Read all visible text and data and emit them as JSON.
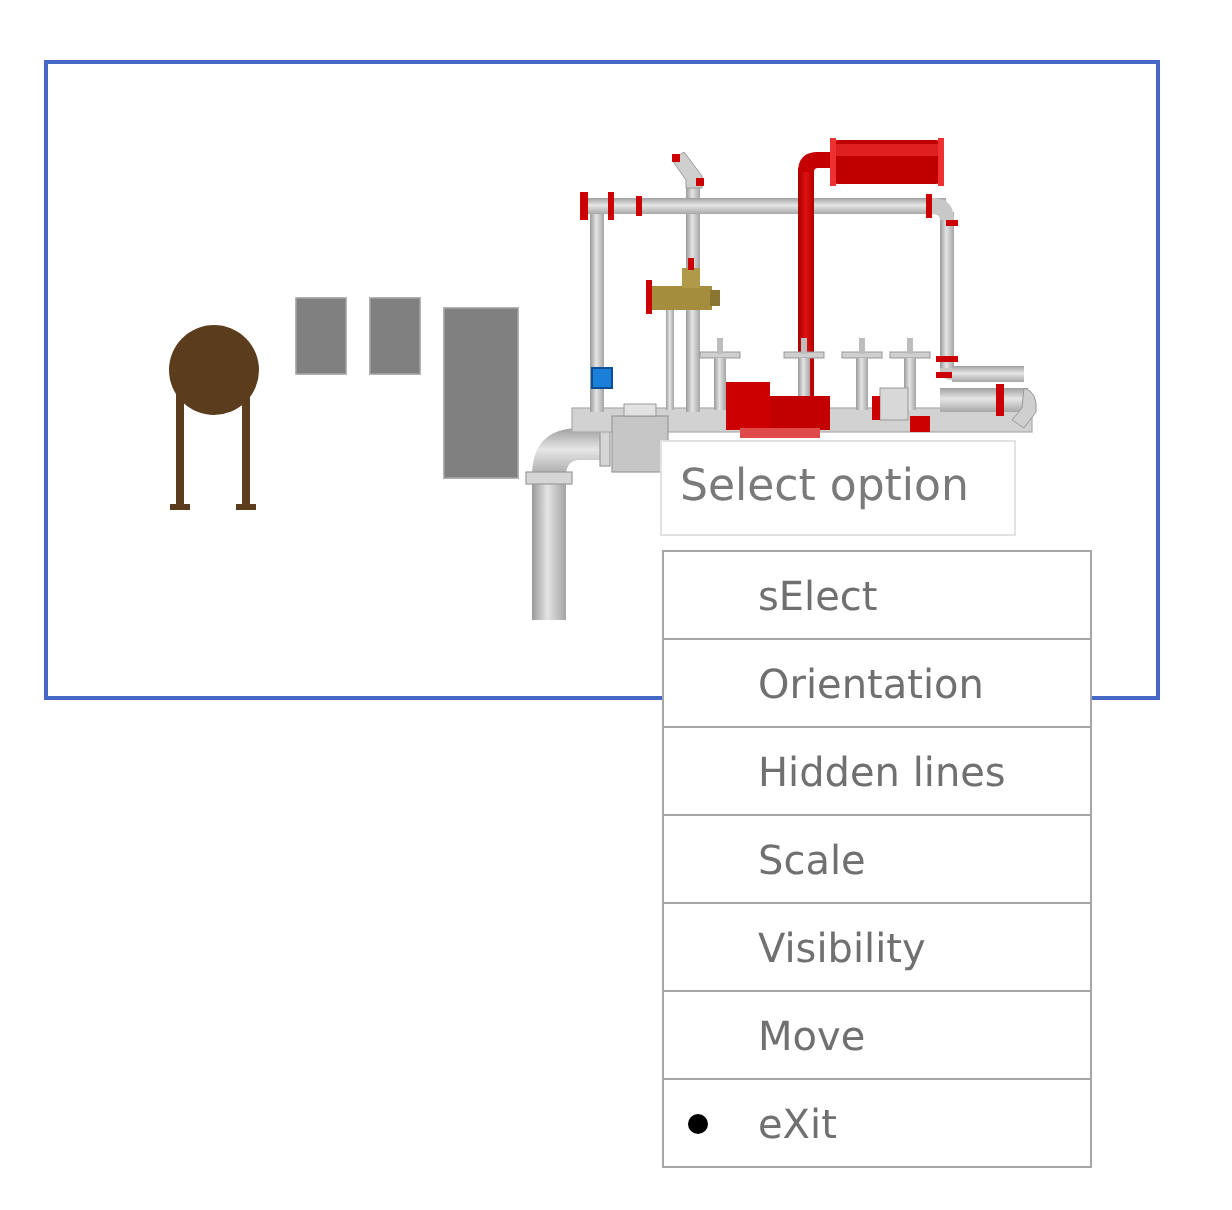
{
  "prompt": {
    "text": "Select option"
  },
  "menu": {
    "items": [
      {
        "label": "sElect",
        "selected": false
      },
      {
        "label": "Orientation",
        "selected": false
      },
      {
        "label": "Hidden lines",
        "selected": false
      },
      {
        "label": "Scale",
        "selected": false
      },
      {
        "label": "Visibility",
        "selected": false
      },
      {
        "label": "Move",
        "selected": false
      },
      {
        "label": "eXit",
        "selected": true
      }
    ]
  }
}
